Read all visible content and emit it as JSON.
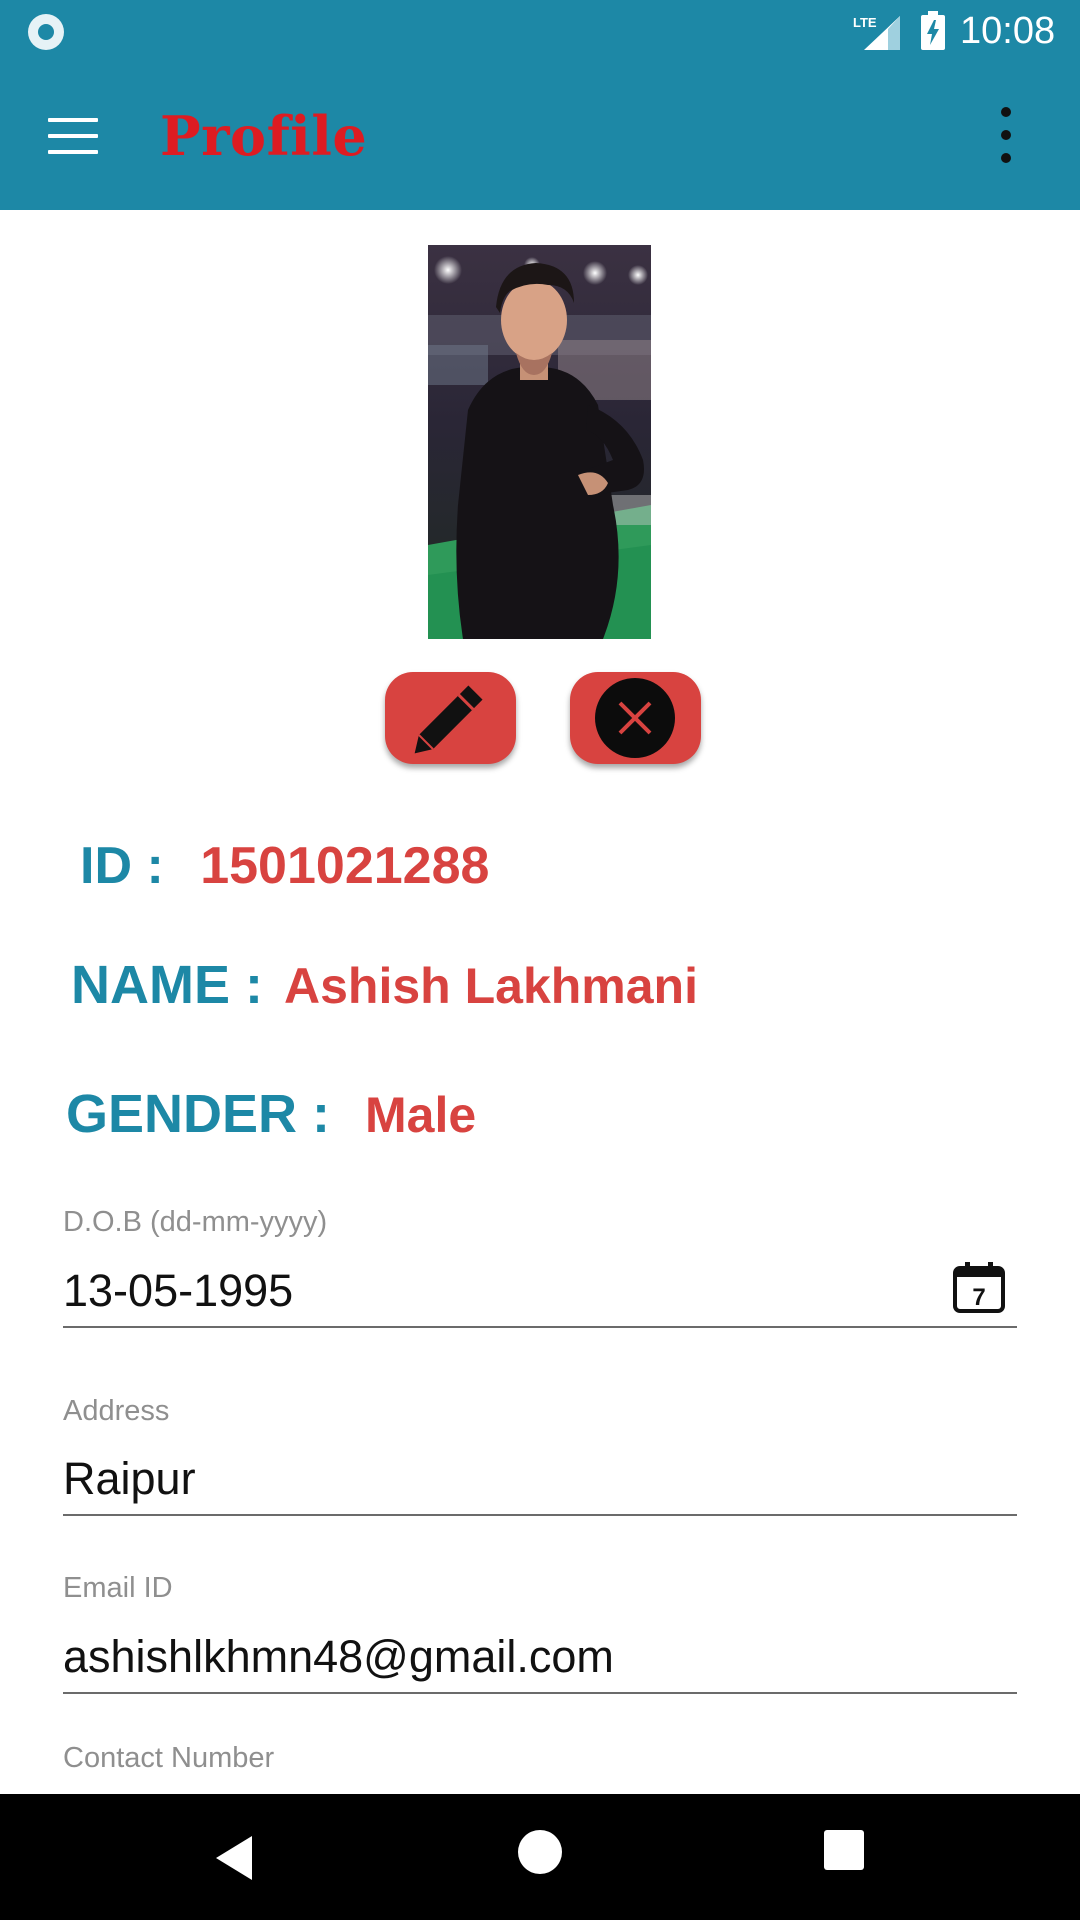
{
  "status_bar": {
    "network_label": "LTE",
    "time": "10:08"
  },
  "app_bar": {
    "title": "Profile",
    "title_color": "#dd1c22",
    "background_color": "#1d88a6"
  },
  "profile": {
    "photo_icon": "person-photo",
    "edit_icon": "pencil-icon",
    "delete_icon": "close-icon",
    "accent_color": "#d84340",
    "id_label": "ID :",
    "id_value": "1501021288",
    "name_label": "NAME :",
    "name_value": "Ashish Lakhmani",
    "gender_label": "GENDER :",
    "gender_value": "Male"
  },
  "form": {
    "dob": {
      "label": "D.O.B (dd-mm-yyyy)",
      "value": "13-05-1995",
      "calendar_day": "7"
    },
    "address": {
      "label": "Address",
      "value": "Raipur"
    },
    "email": {
      "label": "Email ID",
      "value": "ashishlkhmn48@gmail.com"
    },
    "contact": {
      "label": "Contact Number"
    }
  },
  "nav_bar": {
    "back_icon": "back-triangle-icon",
    "home_icon": "home-circle-icon",
    "recents_icon": "recents-square-icon"
  }
}
